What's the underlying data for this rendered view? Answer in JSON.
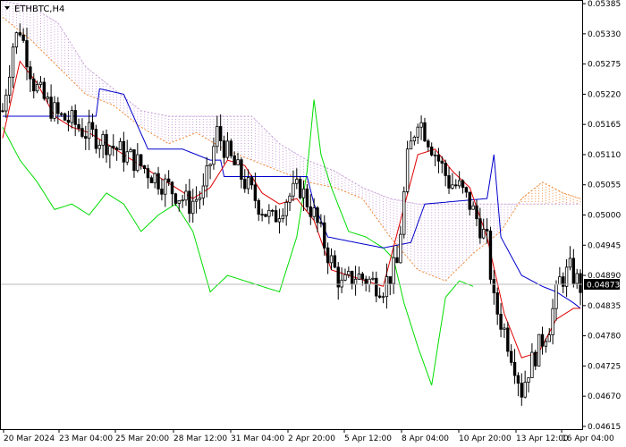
{
  "header": {
    "symbol_label": "ETHBTC,H4"
  },
  "colors": {
    "candle": "#000000",
    "tenkan": "#e00000",
    "kijun": "#0000cc",
    "chikou": "#00dd00",
    "span_a_cloud": "#ee8833",
    "span_b_cloud": "#c8a0d8",
    "current_price_bg": "#000000"
  },
  "chart_data": {
    "type": "candlestick",
    "symbol": "ETHBTC",
    "timeframe": "H4",
    "indicators": [
      "Ichimoku Kinko Hyo"
    ],
    "y_ticks": [
      "0.05385",
      "0.05330",
      "0.05275",
      "0.05220",
      "0.05165",
      "0.05110",
      "0.05055",
      "0.05000",
      "0.04945",
      "0.04890",
      "0.04835",
      "0.04780",
      "0.04725",
      "0.04670",
      "0.04615"
    ],
    "x_ticks": [
      "20 Mar 2024",
      "23 Mar 04:00",
      "25 Mar 20:00",
      "28 Mar 12:00",
      "31 Mar 04:00",
      "2 Apr 20:00",
      "5 Apr 12:00",
      "8 Apr 04:00",
      "10 Apr 20:00",
      "13 Apr 12:00",
      "16 Apr 04:00"
    ],
    "ylim": [
      0.0461,
      0.0539
    ],
    "current_price": "0.04873",
    "close_path": [
      [
        0,
        0.0519
      ],
      [
        3,
        0.0531
      ],
      [
        5,
        0.0534
      ],
      [
        9,
        0.0524
      ],
      [
        12,
        0.0521
      ],
      [
        16,
        0.0518
      ],
      [
        20,
        0.0517
      ],
      [
        24,
        0.0515
      ],
      [
        28,
        0.0514
      ],
      [
        33,
        0.0512
      ],
      [
        38,
        0.051
      ],
      [
        42,
        0.0508
      ],
      [
        46,
        0.0506
      ],
      [
        50,
        0.0504
      ],
      [
        54,
        0.0502
      ],
      [
        58,
        0.0504
      ],
      [
        62,
        0.0515
      ],
      [
        66,
        0.051
      ],
      [
        70,
        0.0506
      ],
      [
        74,
        0.0502
      ],
      [
        78,
        0.0499
      ],
      [
        82,
        0.0503
      ],
      [
        86,
        0.0505
      ],
      [
        90,
        0.05
      ],
      [
        94,
        0.0493
      ],
      [
        98,
        0.0487
      ],
      [
        102,
        0.0489
      ],
      [
        106,
        0.0488
      ],
      [
        110,
        0.0487
      ],
      [
        114,
        0.0491
      ],
      [
        117,
        0.051
      ],
      [
        120,
        0.0518
      ],
      [
        123,
        0.0514
      ],
      [
        126,
        0.051
      ],
      [
        129,
        0.0506
      ],
      [
        132,
        0.0505
      ],
      [
        135,
        0.0502
      ],
      [
        138,
        0.0498
      ],
      [
        140,
        0.0495
      ],
      [
        142,
        0.0484
      ],
      [
        145,
        0.0479
      ],
      [
        148,
        0.0473
      ],
      [
        150,
        0.0468
      ],
      [
        152,
        0.0472
      ],
      [
        155,
        0.0476
      ],
      [
        158,
        0.048
      ],
      [
        161,
        0.0488
      ],
      [
        164,
        0.049
      ],
      [
        167,
        0.0487
      ]
    ],
    "tenkan_sen": [
      [
        0,
        0.0514
      ],
      [
        5,
        0.0528
      ],
      [
        10,
        0.0524
      ],
      [
        15,
        0.0518
      ],
      [
        20,
        0.0516
      ],
      [
        25,
        0.0515
      ],
      [
        30,
        0.0513
      ],
      [
        35,
        0.0511
      ],
      [
        40,
        0.0509
      ],
      [
        45,
        0.0507
      ],
      [
        50,
        0.0505
      ],
      [
        55,
        0.0503
      ],
      [
        60,
        0.0505
      ],
      [
        65,
        0.051
      ],
      [
        70,
        0.0509
      ],
      [
        75,
        0.0504
      ],
      [
        80,
        0.0502
      ],
      [
        85,
        0.0503
      ],
      [
        90,
        0.0499
      ],
      [
        95,
        0.049
      ],
      [
        100,
        0.0489
      ],
      [
        105,
        0.0488
      ],
      [
        110,
        0.0487
      ],
      [
        115,
        0.0499
      ],
      [
        120,
        0.0511
      ],
      [
        125,
        0.0512
      ],
      [
        130,
        0.0508
      ],
      [
        135,
        0.0505
      ],
      [
        140,
        0.0496
      ],
      [
        145,
        0.0482
      ],
      [
        150,
        0.0474
      ],
      [
        155,
        0.0475
      ],
      [
        160,
        0.0481
      ],
      [
        165,
        0.0483
      ]
    ],
    "kijun_sen": [
      [
        0,
        0.0518
      ],
      [
        20,
        0.0518
      ],
      [
        27,
        0.0518
      ],
      [
        28,
        0.0523
      ],
      [
        35,
        0.0522
      ],
      [
        42,
        0.0512
      ],
      [
        52,
        0.0512
      ],
      [
        60,
        0.051
      ],
      [
        63,
        0.051
      ],
      [
        64,
        0.0507
      ],
      [
        88,
        0.0507
      ],
      [
        90,
        0.0502
      ],
      [
        94,
        0.0496
      ],
      [
        110,
        0.0494
      ],
      [
        118,
        0.0495
      ],
      [
        122,
        0.0502
      ],
      [
        140,
        0.0503
      ],
      [
        142,
        0.0511
      ],
      [
        144,
        0.0496
      ],
      [
        150,
        0.0489
      ],
      [
        156,
        0.0487
      ],
      [
        160,
        0.0486
      ],
      [
        165,
        0.0484
      ],
      [
        167,
        0.0483
      ]
    ],
    "chikou_span": [
      [
        0,
        0.0516
      ],
      [
        5,
        0.051
      ],
      [
        10,
        0.0506
      ],
      [
        15,
        0.0501
      ],
      [
        20,
        0.0502
      ],
      [
        25,
        0.05
      ],
      [
        30,
        0.0504
      ],
      [
        35,
        0.0502
      ],
      [
        40,
        0.0497
      ],
      [
        45,
        0.05
      ],
      [
        50,
        0.0502
      ],
      [
        55,
        0.0497
      ],
      [
        60,
        0.0486
      ],
      [
        65,
        0.0489
      ],
      [
        70,
        0.0488
      ],
      [
        75,
        0.0487
      ],
      [
        80,
        0.0486
      ],
      [
        85,
        0.0496
      ],
      [
        88,
        0.0508
      ],
      [
        90,
        0.0521
      ],
      [
        92,
        0.0511
      ],
      [
        95,
        0.0505
      ],
      [
        100,
        0.0497
      ],
      [
        105,
        0.0496
      ],
      [
        110,
        0.0494
      ],
      [
        113,
        0.0492
      ],
      [
        116,
        0.0484
      ],
      [
        120,
        0.0476
      ],
      [
        124,
        0.0469
      ],
      [
        128,
        0.0485
      ],
      [
        132,
        0.0488
      ],
      [
        136,
        0.0487
      ]
    ],
    "senkou_span_a": [
      [
        0,
        0.0536
      ],
      [
        8,
        0.0532
      ],
      [
        16,
        0.0527
      ],
      [
        24,
        0.0522
      ],
      [
        32,
        0.052
      ],
      [
        40,
        0.0516
      ],
      [
        48,
        0.0513
      ],
      [
        56,
        0.0515
      ],
      [
        64,
        0.0512
      ],
      [
        72,
        0.051
      ],
      [
        80,
        0.0508
      ],
      [
        88,
        0.0506
      ],
      [
        96,
        0.0505
      ],
      [
        104,
        0.0503
      ],
      [
        112,
        0.0496
      ],
      [
        120,
        0.049
      ],
      [
        128,
        0.0488
      ],
      [
        136,
        0.0493
      ],
      [
        144,
        0.0497
      ],
      [
        150,
        0.0503
      ],
      [
        156,
        0.0506
      ],
      [
        162,
        0.0504
      ],
      [
        167,
        0.0503
      ]
    ],
    "senkou_span_b": [
      [
        0,
        0.0539
      ],
      [
        8,
        0.0538
      ],
      [
        16,
        0.0535
      ],
      [
        24,
        0.0527
      ],
      [
        32,
        0.0523
      ],
      [
        40,
        0.0519
      ],
      [
        48,
        0.0518
      ],
      [
        56,
        0.0518
      ],
      [
        64,
        0.0518
      ],
      [
        72,
        0.0518
      ],
      [
        80,
        0.0513
      ],
      [
        88,
        0.051
      ],
      [
        96,
        0.0508
      ],
      [
        104,
        0.0505
      ],
      [
        112,
        0.0503
      ],
      [
        120,
        0.0502
      ],
      [
        128,
        0.0502
      ],
      [
        136,
        0.0502
      ],
      [
        144,
        0.0502
      ],
      [
        150,
        0.0502
      ],
      [
        156,
        0.0502
      ],
      [
        162,
        0.0502
      ],
      [
        167,
        0.0502
      ]
    ]
  }
}
